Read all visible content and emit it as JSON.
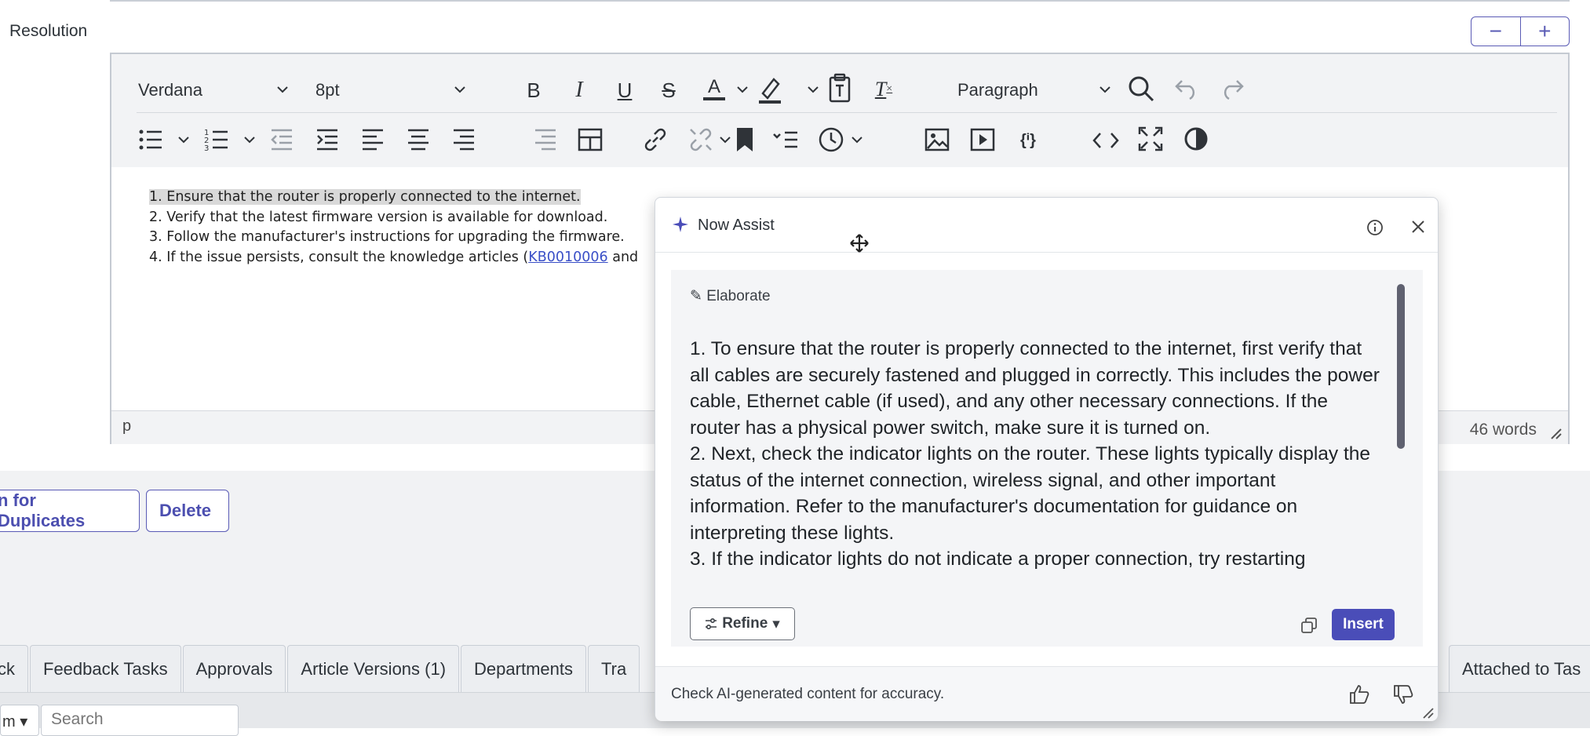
{
  "field": {
    "label": "Resolution"
  },
  "zoom": {
    "minus": "−",
    "plus": "+"
  },
  "toolbar": {
    "font_family": "Verdana",
    "font_size": "8pt",
    "block_format": "Paragraph",
    "icons": [
      "bold-icon",
      "italic-icon",
      "underline-icon",
      "strikethrough-icon",
      "text-color-icon",
      "highlight-icon",
      "paste-text-icon",
      "clear-format-icon",
      "search-icon",
      "undo-icon",
      "redo-icon",
      "bullet-list-icon",
      "numbered-list-icon",
      "outdent-icon",
      "indent-icon",
      "align-left-icon",
      "align-center-icon",
      "align-right-icon",
      "table-icon",
      "link-icon",
      "unlink-icon",
      "bookmark-icon",
      "insert-time-icon",
      "image-icon",
      "video-icon",
      "template-icon",
      "code-icon",
      "fullscreen-icon",
      "contrast-icon"
    ]
  },
  "editor": {
    "items": [
      "1. Ensure that the router is properly connected to the internet.",
      "2. Verify that the latest firmware version is available for download.",
      "3. Follow the manufacturer's instructions for upgrading the firmware.",
      "4. If the issue persists, consult the knowledge articles ("
    ],
    "link_text": "KB0010006",
    "item4_suffix": " and",
    "status_path": "p",
    "word_count": "46 words"
  },
  "actions": {
    "duplicates": "n for Duplicates",
    "delete": "Delete"
  },
  "tabs": [
    "ck",
    "Feedback Tasks",
    "Approvals",
    "Article Versions (1)",
    "Departments",
    "Tra"
  ],
  "tab_right": "Attached to Tas",
  "list_controls": {
    "select_value": "m",
    "search_placeholder": "Search"
  },
  "now_assist": {
    "title": "Now Assist",
    "mode": "Elaborate",
    "paragraphs": [
      "1. To ensure that the router is properly connected to the internet, first verify that all cables are securely fastened and plugged in correctly. This includes the power cable, Ethernet cable (if used), and any other necessary connections. If the router has a physical power switch, make sure it is turned on.",
      "2. Next, check the indicator lights on the router. These lights typically display the status of the internet connection, wireless signal, and other important information. Refer to the manufacturer's documentation for guidance on interpreting these lights.",
      "3. If the indicator lights do not indicate a proper connection, try restarting"
    ],
    "refine_label": "Refine",
    "insert_label": "Insert",
    "footer": "Check AI-generated content for accuracy."
  },
  "colors": {
    "accent": "#4a4db8",
    "outline": "#5a5bb5",
    "highlight": "#d9d9d9"
  }
}
